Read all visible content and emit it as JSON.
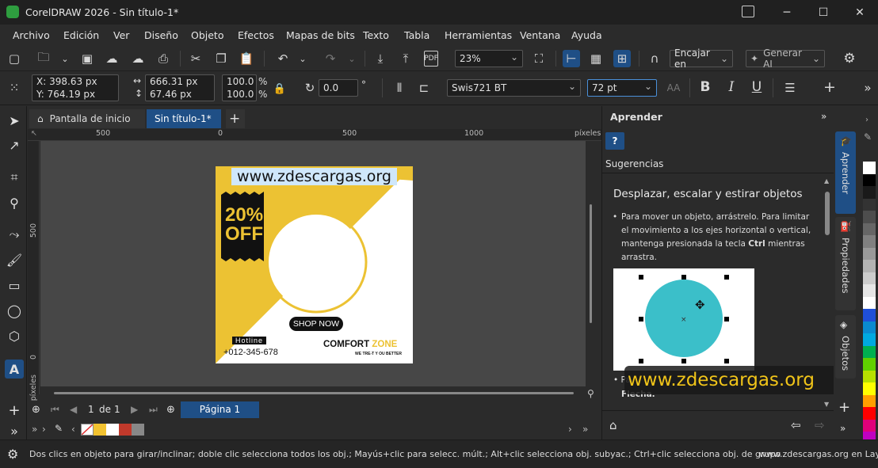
{
  "window": {
    "title": "CorelDRAW 2026 - Sin título-1*",
    "minimize": "─",
    "maximize": "☐",
    "close": "✕"
  },
  "menu": [
    "Archivo",
    "Edición",
    "Ver",
    "Diseño",
    "Objeto",
    "Efectos",
    "Mapas de bits",
    "Texto",
    "Tabla",
    "Herramientas",
    "Ventana",
    "Ayuda"
  ],
  "toolbar": {
    "zoom": "23%",
    "snap_label": "Encajar en",
    "ai_label": "Generar AI"
  },
  "property_bar": {
    "x_label": "X:",
    "x_value": "398.63 px",
    "y_label": "Y:",
    "y_value": "764.19 px",
    "width_value": "666.31 px",
    "height_value": "67.46 px",
    "scale_x": "100.0",
    "scale_y": "100.0",
    "percent": "%",
    "rotation": "0.0",
    "degree": "°",
    "font_name": "Swis721 BT",
    "font_size": "72 pt",
    "bold": "B",
    "italic": "I",
    "underline": "U"
  },
  "tabs": {
    "home_label": "Pantalla de inicio",
    "doc_label": "Sin título-1*",
    "add": "+"
  },
  "ruler": {
    "units": "píxeles",
    "top_ticks": [
      "500",
      "0",
      "500",
      "1000"
    ],
    "left_ticks": [
      "500",
      "0"
    ]
  },
  "artwork": {
    "watermark_text": "www.zdescargas.org",
    "discount_line1": "20%",
    "discount_line2": "OFF",
    "shop_button": "SHOP NOW",
    "hotline_label": "Hotline",
    "phone": "+012-345-678",
    "brand_word1": "COMFORT",
    "brand_word2": "ZONE",
    "tagline": "WE TRE-T Y OU BETTER",
    "colors": {
      "yellow": "#ecc233",
      "black": "#111111"
    }
  },
  "page_nav": {
    "current": "1",
    "of_label": "de",
    "total": "1",
    "page_tab": "Página 1"
  },
  "docker": {
    "title": "Aprender",
    "suggestions_label": "Sugerencias",
    "heading": "Desplazar, escalar y estirar objetos",
    "bullet1_pre": "Para mover un objeto, arrástrelo. Para limitar el movimiento a los ejes horizontal o vertical, mantenga presionada la tecla ",
    "bullet1_key": "Ctrl",
    "bullet1_post": " mientras arrastra.",
    "bullet2_start": "Pa",
    "bullet2_key": "Flecha.",
    "overlay_watermark": "www.zdescargas.org",
    "help_icon_text": "?",
    "circle_color": "#3bbfc9"
  },
  "side_tabs": [
    "Aprender",
    "Propiedades",
    "Objetos"
  ],
  "palette": [
    "#ffffff",
    "#000000",
    "#1a1a1a",
    "#333333",
    "#4d4d4d",
    "#666666",
    "#808080",
    "#999999",
    "#b3b3b3",
    "#cccccc",
    "#e6e6e6",
    "#ffffff",
    "#1f4fd8",
    "#0a8ad0",
    "#00a9e0",
    "#00b050",
    "#60d000",
    "#b7e000",
    "#ffff00",
    "#ff9f00",
    "#ff0000",
    "#e0007a",
    "#c000c0",
    "#7a00d0"
  ],
  "recent_colors": [
    "#ffffff",
    "#f2c230",
    "#ffffff",
    "#c0392b",
    "#888888"
  ],
  "status": {
    "hint": "Dos clics en objeto para girar/inclinar; doble clic selecciona todos los obj.; Mayús+clic para selecc. múlt.; Alt+clic selecciona obj. subyac.; Ctrl+clic selecciona obj. de grupo",
    "right": "www.zdescargas.org en Lay"
  }
}
